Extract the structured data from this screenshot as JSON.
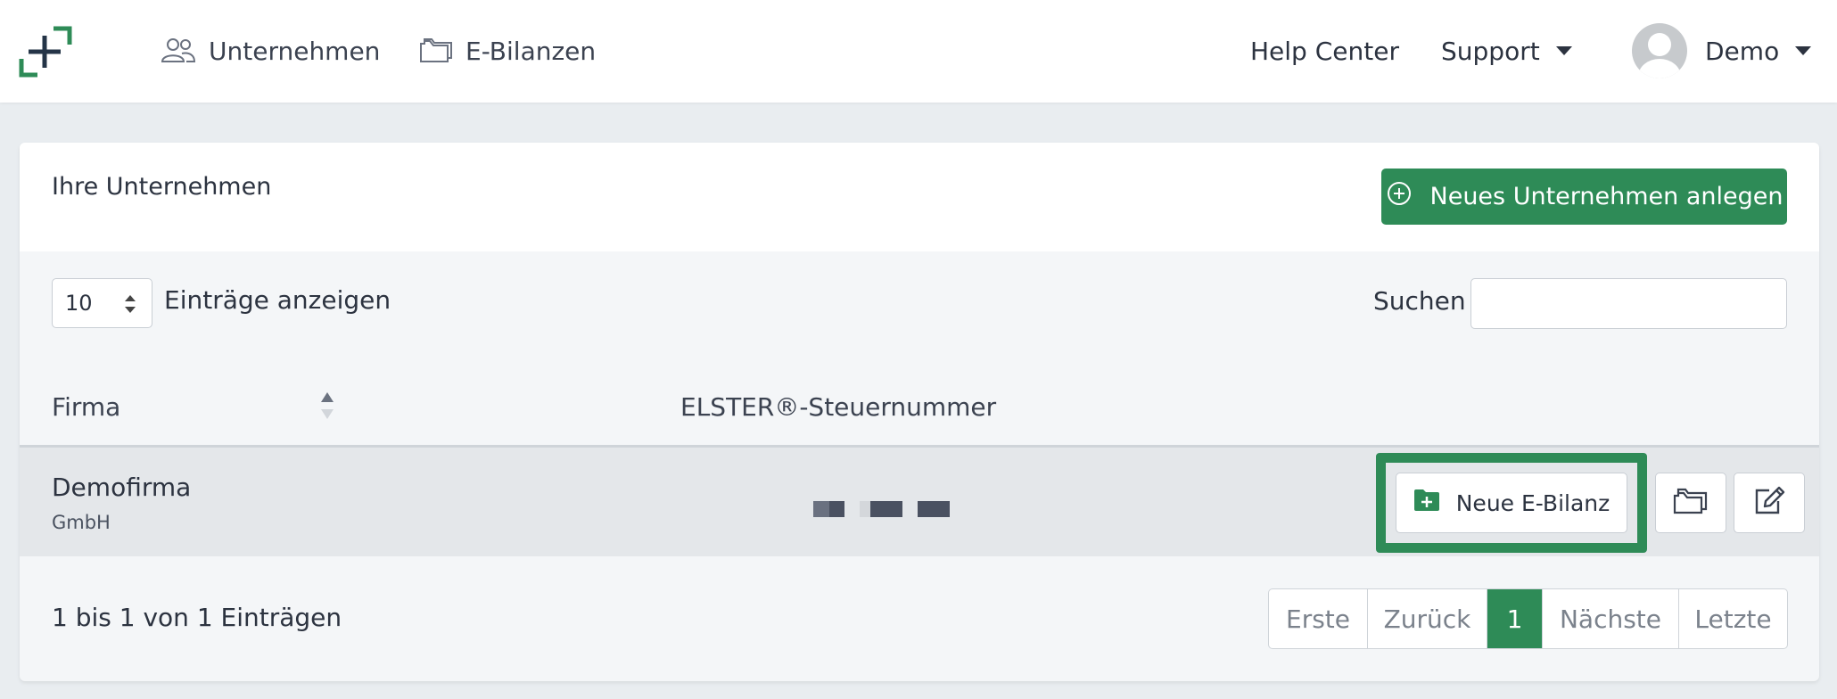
{
  "nav": {
    "companies_label": "Unternehmen",
    "ebilanzen_label": "E-Bilanzen",
    "help_label": "Help Center",
    "support_label": "Support",
    "user_label": "Demo"
  },
  "card": {
    "title": "Ihre Unternehmen",
    "new_company_label": "Neues Unternehmen anlegen"
  },
  "table_controls": {
    "page_length": "10",
    "page_length_label": "Einträge anzeigen",
    "search_label": "Suchen",
    "search_value": ""
  },
  "table": {
    "columns": [
      "Firma",
      "ELSTER®-Steuernummer"
    ],
    "rows": [
      {
        "name": "Demofirma",
        "legal_form": "GmbH",
        "tax_number": "masked"
      }
    ],
    "row_action_new": "Neue E-Bilanz"
  },
  "footer": {
    "info": "1 bis 1 von 1 Einträgen",
    "pagination": [
      "Erste",
      "Zurück",
      "1",
      "Nächste",
      "Letzte"
    ],
    "current_page": "1"
  },
  "colors": {
    "brand_green": "#2e8b57",
    "highlight_green": "#2e8b57",
    "logo_dark": "#243447"
  },
  "icons": {
    "companies": "users-icon",
    "ebilanzen": "folder-icon",
    "new_company": "plus-circle-icon",
    "new_ebilanz": "folder-plus-icon",
    "open": "folder-open-icon",
    "edit": "edit-icon"
  }
}
